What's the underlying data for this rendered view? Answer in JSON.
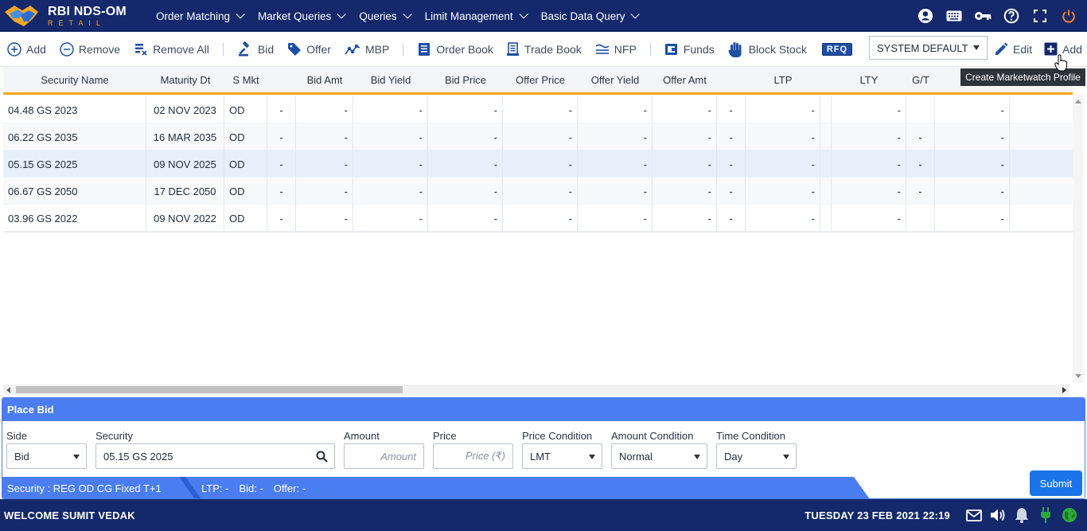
{
  "app": {
    "title": "RBI NDS-OM",
    "subtitle": "RETAIL"
  },
  "nav": {
    "items": [
      {
        "label": "Order Matching"
      },
      {
        "label": "Market Queries"
      },
      {
        "label": "Queries"
      },
      {
        "label": "Limit Management"
      },
      {
        "label": "Basic Data Query"
      }
    ],
    "icons": [
      "user-icon",
      "keyboard-icon",
      "key-icon",
      "help-icon",
      "fullscreen-icon",
      "power-icon"
    ]
  },
  "toolbar": {
    "add": "Add",
    "remove": "Remove",
    "remove_all": "Remove All",
    "bid": "Bid",
    "offer": "Offer",
    "mbp": "MBP",
    "order_book": "Order Book",
    "trade_book": "Trade Book",
    "nfp": "NFP",
    "funds": "Funds",
    "block_stock": "Block Stock",
    "rfq": "RFQ",
    "profile": "SYSTEM DEFAULT",
    "edit": "Edit",
    "add_profile": "Add",
    "tooltip": "Create Marketwatch Profile"
  },
  "grid": {
    "columns": [
      "Security Name",
      "Maturity Dt",
      "S Mkt",
      "Bid Amt",
      "Bid Yield",
      "Bid Price",
      "Offer Price",
      "Offer Yield",
      "Offer Amt",
      "LTP",
      "LTY",
      "G/T"
    ],
    "rows": [
      {
        "security": "04.48 GS 2023",
        "maturity": "02 NOV 2023",
        "smkt": "OD",
        "c1": "-",
        "bid_amt": "-",
        "bid_yield": "-",
        "bid_price": "-",
        "offer_price": "-",
        "offer_yield": "-",
        "offer_amt": "-",
        "c2": "-",
        "ltp": "-",
        "lty": "-",
        "gt": "",
        "c3": "-"
      },
      {
        "security": "06.22 GS 2035",
        "maturity": "16 MAR 2035",
        "smkt": "OD",
        "c1": "-",
        "bid_amt": "-",
        "bid_yield": "-",
        "bid_price": "-",
        "offer_price": "-",
        "offer_yield": "-",
        "offer_amt": "-",
        "c2": "-",
        "ltp": "-",
        "lty": "-",
        "gt": "-",
        "c3": "-"
      },
      {
        "security": "05.15 GS 2025",
        "maturity": "09 NOV 2025",
        "smkt": "OD",
        "c1": "-",
        "bid_amt": "-",
        "bid_yield": "-",
        "bid_price": "-",
        "offer_price": "-",
        "offer_yield": "-",
        "offer_amt": "-",
        "c2": "-",
        "ltp": "-",
        "lty": "-",
        "gt": "-",
        "c3": "-"
      },
      {
        "security": "06.67 GS 2050",
        "maturity": "17 DEC 2050",
        "smkt": "OD",
        "c1": "-",
        "bid_amt": "-",
        "bid_yield": "-",
        "bid_price": "-",
        "offer_price": "-",
        "offer_yield": "-",
        "offer_amt": "-",
        "c2": "-",
        "ltp": "-",
        "lty": "-",
        "gt": "-",
        "c3": "-"
      },
      {
        "security": "03.96 GS 2022",
        "maturity": "09 NOV 2022",
        "smkt": "OD",
        "c1": "-",
        "bid_amt": "-",
        "bid_yield": "-",
        "bid_price": "-",
        "offer_price": "-",
        "offer_yield": "-",
        "offer_amt": "-",
        "c2": "-",
        "ltp": "-",
        "lty": "-",
        "gt": "",
        "c3": "-"
      }
    ]
  },
  "place_bid": {
    "title": "Place Bid",
    "side_label": "Side",
    "side_value": "Bid",
    "security_label": "Security",
    "security_value": "05.15 GS 2025",
    "amount_label": "Amount",
    "amount_placeholder": "Amount",
    "price_label": "Price",
    "price_placeholder": "Price (₹)",
    "price_condition_label": "Price Condition",
    "price_condition_value": "LMT",
    "amount_condition_label": "Amount Condition",
    "amount_condition_value": "Normal",
    "time_condition_label": "Time Condition",
    "time_condition_value": "Day",
    "status_security": "Security : REG OD CG Fixed T+1",
    "status_ltp": "LTP: -",
    "status_bid": "Bid: -",
    "status_offer": "Offer: -",
    "submit": "Submit"
  },
  "footer": {
    "welcome": "WELCOME SUMIT VEDAK",
    "datetime": "TUESDAY 23 FEB 2021 22:19"
  },
  "colors": {
    "nav_bg": "#14286b",
    "accent": "#4a7df0",
    "orange": "#f5a623",
    "submit": "#1a73e8"
  }
}
